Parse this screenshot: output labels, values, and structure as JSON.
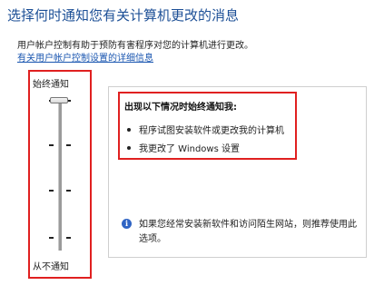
{
  "header": {
    "title": "选择何时通知您有关计算机更改的消息",
    "description": "用户帐户控制有助于预防有害程序对您的计算机进行更改。",
    "link": "有关用户帐户控制设置的详细信息"
  },
  "slider": {
    "top_label": "始终通知",
    "bottom_label": "从不通知",
    "level": "始终通知",
    "level_index_from_top": 0,
    "level_count": 4
  },
  "panel": {
    "heading": "出现以下情况时始终通知我:",
    "bullets": [
      "程序试图安装软件或更改我的计算机",
      "我更改了 Windows 设置"
    ],
    "info_icon": "info-icon",
    "info_text": "如果您经常安装新软件和访问陌生网站，则推荐使用此选项。"
  },
  "colors": {
    "title": "#1c4f96",
    "link": "#1a56b0",
    "highlight": "#e02020",
    "info_icon": "#2f64c4"
  }
}
